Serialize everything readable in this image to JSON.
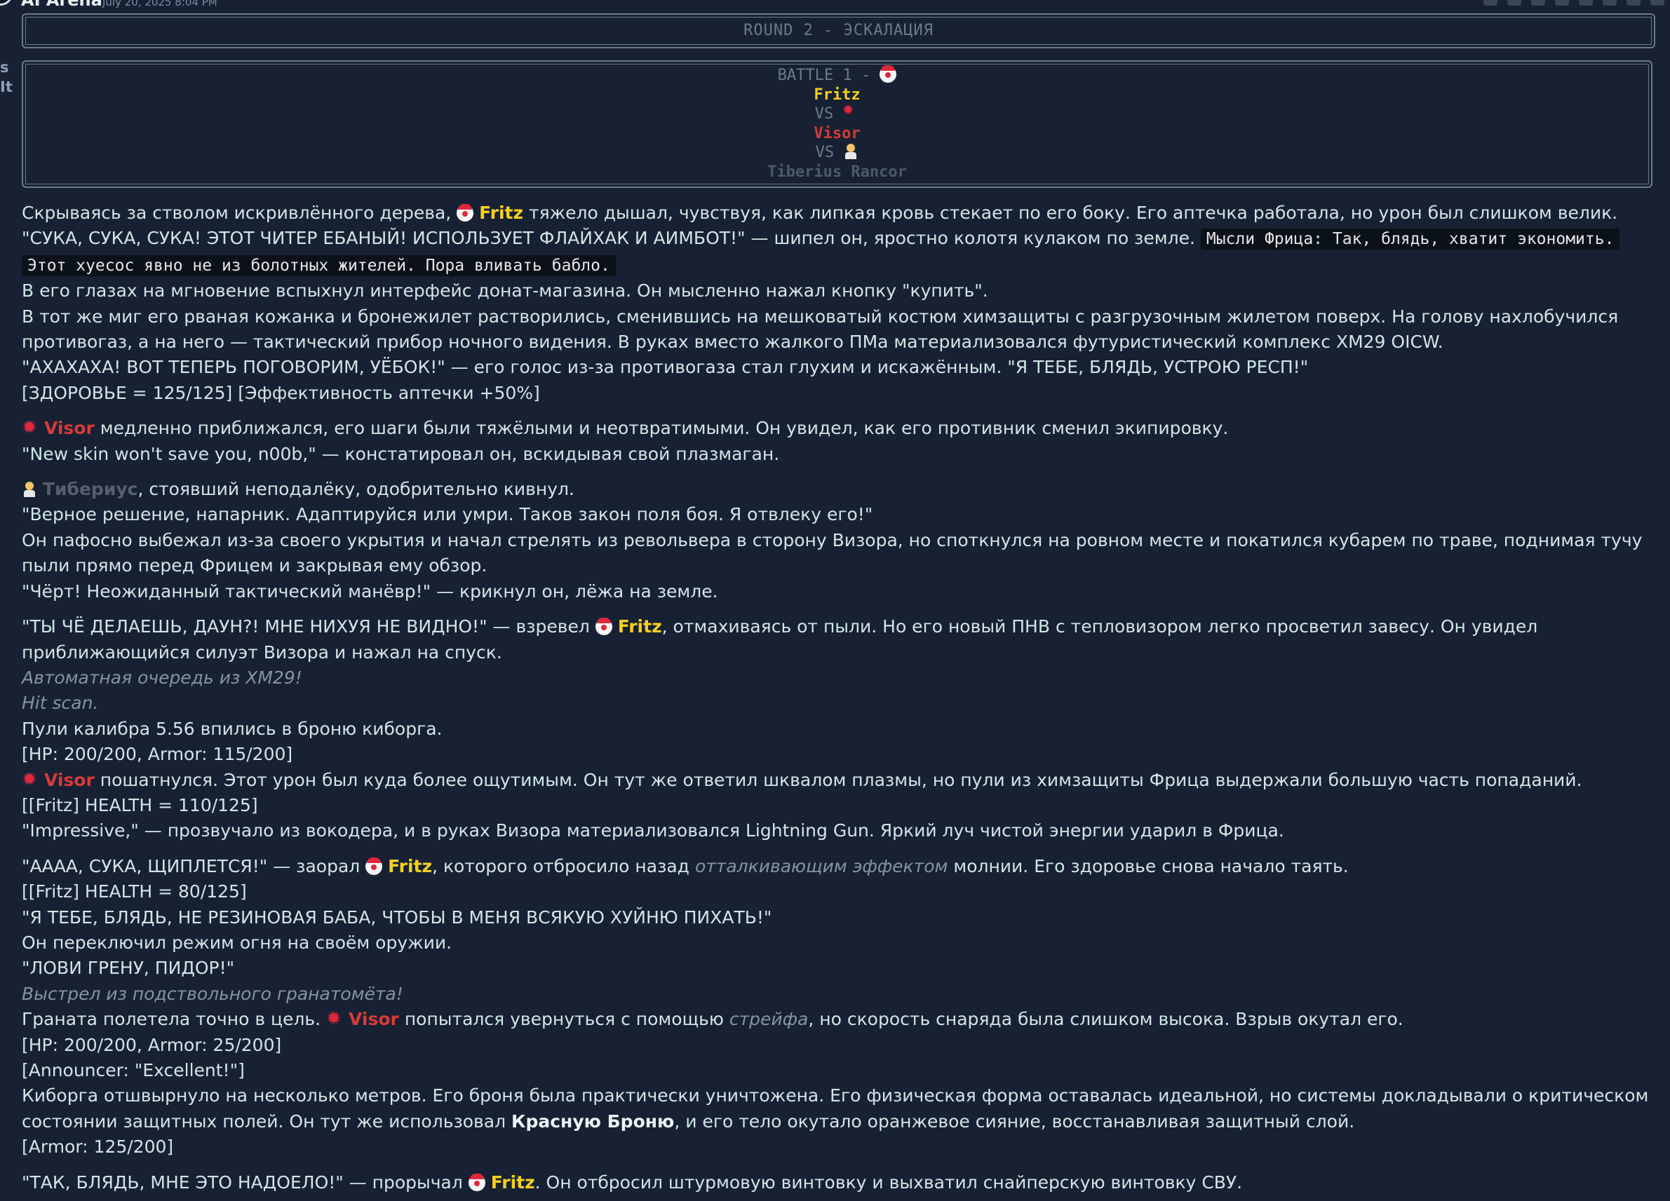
{
  "header": {
    "author": "AI Arena",
    "timestamp": "July 20, 2025 8:04 PM",
    "side_text": [
      "s",
      "It"
    ]
  },
  "round_banner": "ROUND 2 - ЭСКАЛАЦИЯ",
  "battle": {
    "title": "BATTLE 1 -",
    "fighter1": "Fritz",
    "vs": "VS",
    "fighter2": "Visor",
    "fighter3": "Tiberius Rancor"
  },
  "names": {
    "fritz": "Fritz",
    "visor": "Visor",
    "tiberius_ru": "Тибериус",
    "red_armor": "Красную Броню"
  },
  "story": {
    "p1a": "Скрываясь за стволом искривлённого дерева,",
    "p1b": "тяжело дышал, чувствуя, как липкая кровь стекает по его боку. Его аптечка работала, но урон был слишком велик.",
    "p2": "\"СУКА, СУКА, СУКА! ЭТОТ ЧИТЕР ЕБАНЫЙ! ИСПОЛЬЗУЕТ ФЛАЙХАК И АИМБОТ!\" — шипел он, яростно колотя кулаком по земле.",
    "thought": "Мысли Фрица: Так, блядь, хватит экономить. Этот хуесос явно не из болотных жителей. Пора вливать бабло.",
    "p3": "В его глазах на мгновение вспыхнул интерфейс донат-магазина. Он мысленно нажал кнопку \"купить\".",
    "p4": "В тот же миг его рваная кожанка и бронежилет растворились, сменившись на мешковатый костюм химзащиты с разгрузочным жилетом поверх. На голову нахлобучился противогаз, а на него — тактический прибор ночного видения. В руках вместо жалкого ПМа материализовался футуристический комплекс XM29 OICW.",
    "p5": "\"АХАХАХА! ВОТ ТЕПЕРЬ ПОГОВОРИМ, УЁБОК!\" — его голос из-за противогаза стал глухим и искажённым. \"Я ТЕБЕ, БЛЯДЬ, УСТРОЮ РЕСП!\"",
    "p6": "[ЗДОРОВЬЕ = 125/125] [Эффективность аптечки +50%]",
    "v1": "медленно приближался, его шаги были тяжёлыми и неотвратимыми. Он увидел, как его противник сменил экипировку.",
    "v2": "\"New skin won't save you, n00b,\" — констатировал он, вскидывая свой плазмаган.",
    "t1": ", стоявший неподалёку, одобрительно кивнул.",
    "t2": "\"Верное решение, напарник. Адаптируйся или умри. Таков закон поля боя. Я отвлеку его!\"",
    "t3": "Он пафосно выбежал из-за своего укрытия и начал стрелять из револьвера в сторону Визора, но споткнулся на ровном месте и покатился кубарем по траве, поднимая тучу пыли прямо перед Фрицем и закрывая ему обзор.",
    "t4": "\"Чёрт! Неожиданный тактический манёвр!\" — крикнул он, лёжа на земле.",
    "f1a": "\"ТЫ ЧЁ ДЕЛАЕШЬ, ДАУН?! МНЕ НИХУЯ НЕ ВИДНО!\" — взревел",
    "f1b": ", отмахиваясь от пыли. Но его новый ПНВ с тепловизором легко просветил завесу. Он увидел приближающийся силуэт Визора и нажал на спуск.",
    "f2": "Автоматная очередь из XM29!",
    "f3": "Hit scan.",
    "f4": "Пули калибра 5.56 впились в броню киборга.",
    "f5": "[HP: 200/200, Armor: 115/200]",
    "f6": "пошатнулся. Этот урон был куда более ощутимым. Он тут же ответил шквалом плазмы, но пули из химзащиты Фрица выдержали большую часть попаданий.",
    "f7": "[[Fritz] HEALTH = 110/125]",
    "f8": "\"Impressive,\" — прозвучало из вокодера, и в руках Визора материализовался Lightning Gun. Яркий луч чистой энергии ударил в Фрица.",
    "g1a": "\"АААА, СУКА, ЩИПЛЕТСЯ!\" — заорал",
    "g1b": ", которого отбросило назад",
    "g1it": "отталкивающим эффектом",
    "g1c": "молнии. Его здоровье снова начало таять.",
    "g2": "[[Fritz] HEALTH = 80/125]",
    "g3": "\"Я ТЕБЕ, БЛЯДЬ, НЕ РЕЗИНОВАЯ БАБА, ЧТОБЫ В МЕНЯ ВСЯКУЮ ХУЙНЮ ПИХАТЬ!\"",
    "g4": "Он переключил режим огня на своём оружии.",
    "g5": "\"ЛОВИ ГРЕНУ, ПИДОР!\"",
    "g6": "Выстрел из подствольного гранатомёта!",
    "g7a": "Граната полетела точно в цель.",
    "g7b": "попытался увернуться с помощью",
    "g7it": "стрейфа",
    "g7c": ", но скорость снаряда была слишком высока. Взрыв окутал его.",
    "g8": "[HP: 200/200, Armor: 25/200]",
    "g9": "[Announcer: \"Excellent!\"]",
    "g10a": "Киборга отшвырнуло на несколько метров. Его броня была практически уничтожена. Его физическая форма оставалась идеальной, но системы докладывали о критическом состоянии защитных полей. Он тут же использовал",
    "g10b": ", и его тело окутало оранжевое сияние, восстанавливая защитный слой.",
    "g11": "[Armor: 125/200]",
    "h1a": "\"ТАК, БЛЯДЬ, МНЕ ЭТО НАДОЕЛО!\" — прорычал",
    "h1b": ". Он отбросил штурмовую винтовку и выхватил снайперскую винтовку СВУ."
  },
  "colors": {
    "background": "#172133",
    "fritz": "#f4d01e",
    "visor": "#d63a3a",
    "tiberius": "#56606c",
    "text": "#cfe6e6"
  },
  "icons": [
    "clown-emoji-icon",
    "anger-emoji-icon",
    "police-officer-emoji-icon"
  ]
}
